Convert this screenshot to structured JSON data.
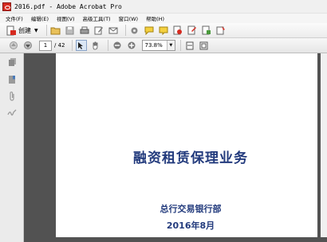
{
  "window": {
    "title": "2016.pdf - Adobe Acrobat Pro"
  },
  "menu": {
    "items": [
      "文件(F)",
      "编辑(E)",
      "视图(V)",
      "高级工具(T)",
      "窗口(W)",
      "帮助(H)"
    ]
  },
  "toolbar": {
    "create_label": "创建",
    "icons": [
      "open-folder",
      "save",
      "print",
      "edit",
      "email",
      "settings",
      "comment",
      "stamp",
      "secure",
      "sign",
      "review",
      "form"
    ]
  },
  "nav": {
    "current_page": "1",
    "total_pages": "/ 42",
    "zoom": "73.8%"
  },
  "document": {
    "title": "融资租赁保理业务",
    "department": "总行交易银行部",
    "date": "2016年8月"
  },
  "colors": {
    "doc_text": "#233b7d",
    "doc_bg": "#525252"
  }
}
